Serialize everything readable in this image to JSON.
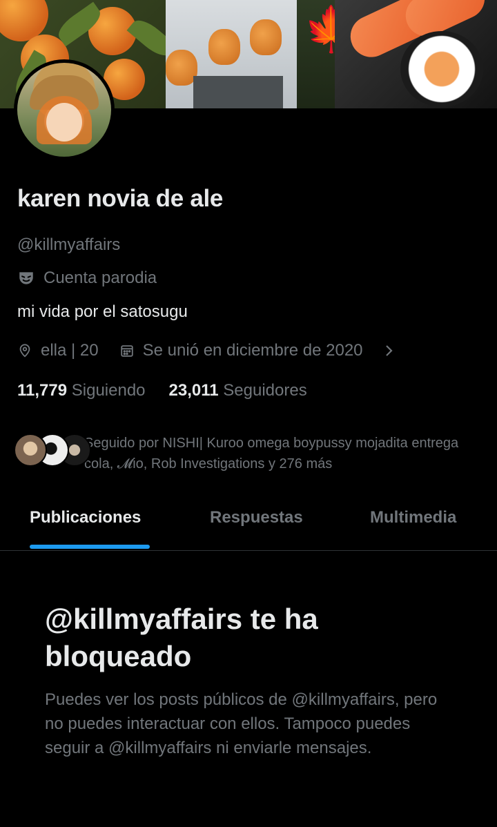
{
  "profile": {
    "display_name": "karen novia de ale",
    "handle": "@killmyaffairs",
    "parody_label": "Cuenta parodia",
    "bio": "mi vida por el satosugu",
    "location": "ella | 20",
    "joined": "Se unió en diciembre de 2020",
    "following_count": "11,779",
    "following_label": "Siguiendo",
    "followers_count": "23,011",
    "followers_label": "Seguidores",
    "followed_by": "Seguido por NISHI| Kuroo omega boypussy mojadita entrega cola, 𝓜io, Rob Investigations y 276 más"
  },
  "tabs": [
    {
      "label": "Publicaciones",
      "active": true
    },
    {
      "label": "Respuestas",
      "active": false
    },
    {
      "label": "Multimedia",
      "active": false
    }
  ],
  "blocked": {
    "title": "@killmyaffairs te ha bloqueado",
    "description": "Puedes ver los posts públicos de @killmyaffairs, pero no puedes interactuar con ellos. Tampoco puedes seguir a @killmyaffairs ni enviarle mensajes."
  },
  "icons": {
    "parody": "theater-mask-icon",
    "location": "location-pin-icon",
    "calendar": "calendar-icon",
    "chevron": "chevron-right-icon"
  },
  "colors": {
    "background": "#000000",
    "primary_text": "#e7e9ea",
    "secondary_text": "#71767b",
    "accent": "#1d9bf0",
    "divider": "#2f3336"
  }
}
